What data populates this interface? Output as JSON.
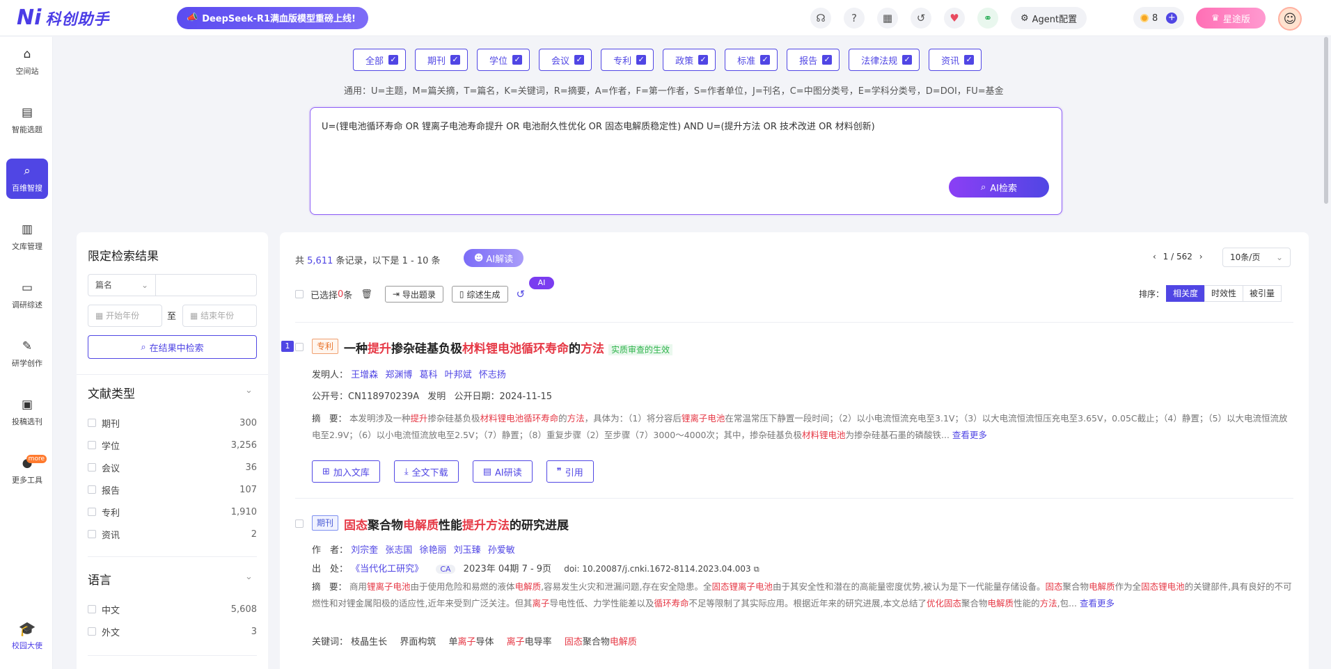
{
  "header": {
    "logo_mark": "Ni",
    "logo_text": "科创助手",
    "banner_text": "DeepSeek-R1满血版模型重磅上线!",
    "agent_label": "Agent配置",
    "coins": "8",
    "vip_label": "星途版",
    "icons": [
      "headset-icon",
      "help-icon",
      "calendar-icon",
      "history-icon",
      "heart-icon",
      "link-icon"
    ]
  },
  "nav": {
    "items": [
      {
        "label": "空间站",
        "icon": "⌂"
      },
      {
        "label": "智能选题",
        "icon": "▤"
      },
      {
        "label": "百维智搜",
        "icon": "⌕"
      },
      {
        "label": "文库管理",
        "icon": "▥"
      },
      {
        "label": "调研综述",
        "icon": "▭"
      },
      {
        "label": "研学创作",
        "icon": "✎"
      },
      {
        "label": "投稿选刊",
        "icon": "▣"
      },
      {
        "label": "更多工具",
        "icon": "●"
      }
    ],
    "more_badge": "more",
    "campus": "校园大使"
  },
  "types": [
    "全部",
    "期刊",
    "学位",
    "会议",
    "专利",
    "政策",
    "标准",
    "报告",
    "法律法规",
    "资讯"
  ],
  "hint": "通用：U=主题，M=篇关摘，T=篇名，K=关键词，R=摘要，A=作者，F=第一作者，S=作者单位，J=刊名，C=中图分类号，E=学科分类号，D=DOI，FU=基金",
  "query": "U=(锂电池循环寿命 OR 锂离子电池寿命提升 OR 电池耐久性优化 OR 固态电解质稳定性) AND U=(提升方法 OR 技术改进 OR 材料创新)",
  "ai_search_label": "AI检索",
  "filter": {
    "title": "限定检索结果",
    "field_select": "篇名",
    "start_year": "开始年份",
    "to": "至",
    "end_year": "结束年份",
    "search_btn": "在结果中检索",
    "doc_type_title": "文献类型",
    "doc_types": [
      {
        "label": "期刊",
        "count": "300"
      },
      {
        "label": "学位",
        "count": "3,256"
      },
      {
        "label": "会议",
        "count": "36"
      },
      {
        "label": "报告",
        "count": "107"
      },
      {
        "label": "专利",
        "count": "1,910"
      },
      {
        "label": "资讯",
        "count": "2"
      }
    ],
    "lang_title": "语言",
    "langs": [
      {
        "label": "中文",
        "count": "5,608"
      },
      {
        "label": "外文",
        "count": "3"
      }
    ]
  },
  "results": {
    "summary_prefix": "共",
    "total": "5,611",
    "summary_suffix": "条记录，以下是 1 - 10 条",
    "ai_read": "AI解读",
    "pager": "1 / 562",
    "per_page": "10条/页",
    "selected_prefix": "已选择",
    "selected_count": "0",
    "selected_suffix": "条",
    "export": "导出题录",
    "review": "综述生成",
    "ai_tag": "AI",
    "sort_label": "排序：",
    "sorts": [
      "相关度",
      "时效性",
      "被引量"
    ],
    "items": [
      {
        "index": "1",
        "tag": "专利",
        "status": "实质审查的生效",
        "inventor_label": "发明人：",
        "inventors": [
          "王增森",
          "郑渊博",
          "葛科",
          "叶邦斌",
          "怀志扬"
        ],
        "pubno": "公开号：CN118970239A",
        "kind": "发明",
        "pubdate": "公开日期：2024-11-15",
        "abstract_label": "摘　要：",
        "more": "查看更多",
        "actions": [
          "加入文库",
          "全文下载",
          "AI研读",
          "引用"
        ]
      },
      {
        "tag": "期刊",
        "author_label": "作　者：",
        "authors": [
          "刘宗奎",
          "张志国",
          "徐艳丽",
          "刘玉臻",
          "孙爱敏"
        ],
        "source_label": "出　处：",
        "journal": "《当代化工研究》",
        "ca": "CA",
        "issue": "2023年 04期 7 - 9页",
        "doi": "doi: 10.20087/j.cnki.1672-8114.2023.04.003",
        "abstract_label": "摘　要：",
        "more": "查看更多",
        "keyword_label": "关键词："
      }
    ]
  }
}
